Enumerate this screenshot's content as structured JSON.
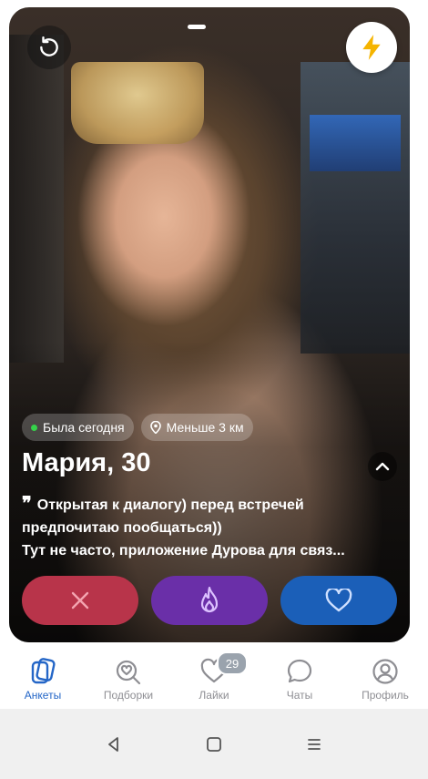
{
  "profile": {
    "status_online": "Была сегодня",
    "distance": "Меньше 3 км",
    "name_age": "Мария, 30",
    "bio_line1": "Открытая к диалогу) перед встречей предпочитаю пообщаться))",
    "bio_line2": "Тут не часто, приложение Дурова для связ..."
  },
  "actions": [
    "dislike",
    "superlike",
    "like"
  ],
  "tabs": [
    {
      "label": "Анкеты",
      "icon": "cards-icon",
      "active": true
    },
    {
      "label": "Подборки",
      "icon": "heart-search-icon"
    },
    {
      "label": "Лайки",
      "icon": "heart-icon",
      "badge": "29"
    },
    {
      "label": "Чаты",
      "icon": "chat-icon"
    },
    {
      "label": "Профиль",
      "icon": "profile-icon"
    }
  ],
  "colors": {
    "accent": "#2466c7",
    "dislike": "#b8344a",
    "superlike": "#6a2fa8",
    "like": "#1b5fb8",
    "boost": "#f5b400",
    "online": "#35d24a"
  }
}
